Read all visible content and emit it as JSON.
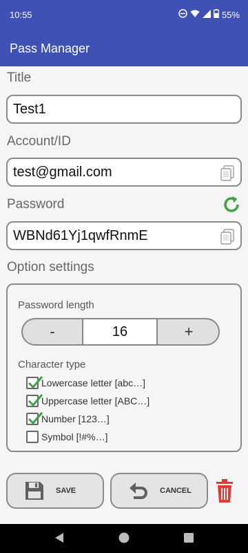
{
  "status_bar": {
    "time": "10:55",
    "battery": "55%",
    "icons": [
      "dnd-icon",
      "wifi-icon",
      "signal-icon",
      "battery-icon"
    ]
  },
  "app_bar": {
    "title": "Pass Manager"
  },
  "form": {
    "title_label": "Title",
    "title_value": "Test1",
    "account_label": "Account/ID",
    "account_value": "test@gmail.com",
    "password_label": "Password",
    "password_value": "WBNd61Yj1qwfRnmE"
  },
  "options": {
    "heading": "Option settings",
    "length_label": "Password length",
    "minus": "-",
    "length_value": "16",
    "plus": "+",
    "char_type_label": "Character type",
    "char_types": [
      {
        "label": "Lowercase letter [abc…]",
        "checked": true
      },
      {
        "label": "Uppercase letter [ABC…]",
        "checked": true
      },
      {
        "label": "Number [123…]",
        "checked": true
      },
      {
        "label": "Symbol [!#%…]",
        "checked": false
      }
    ]
  },
  "actions": {
    "save": "SAVE",
    "cancel": "CANCEL"
  },
  "colors": {
    "primary": "#3f51b5",
    "check_green": "#43a047",
    "refresh_green": "#43a047",
    "trash_red": "#e53935"
  }
}
